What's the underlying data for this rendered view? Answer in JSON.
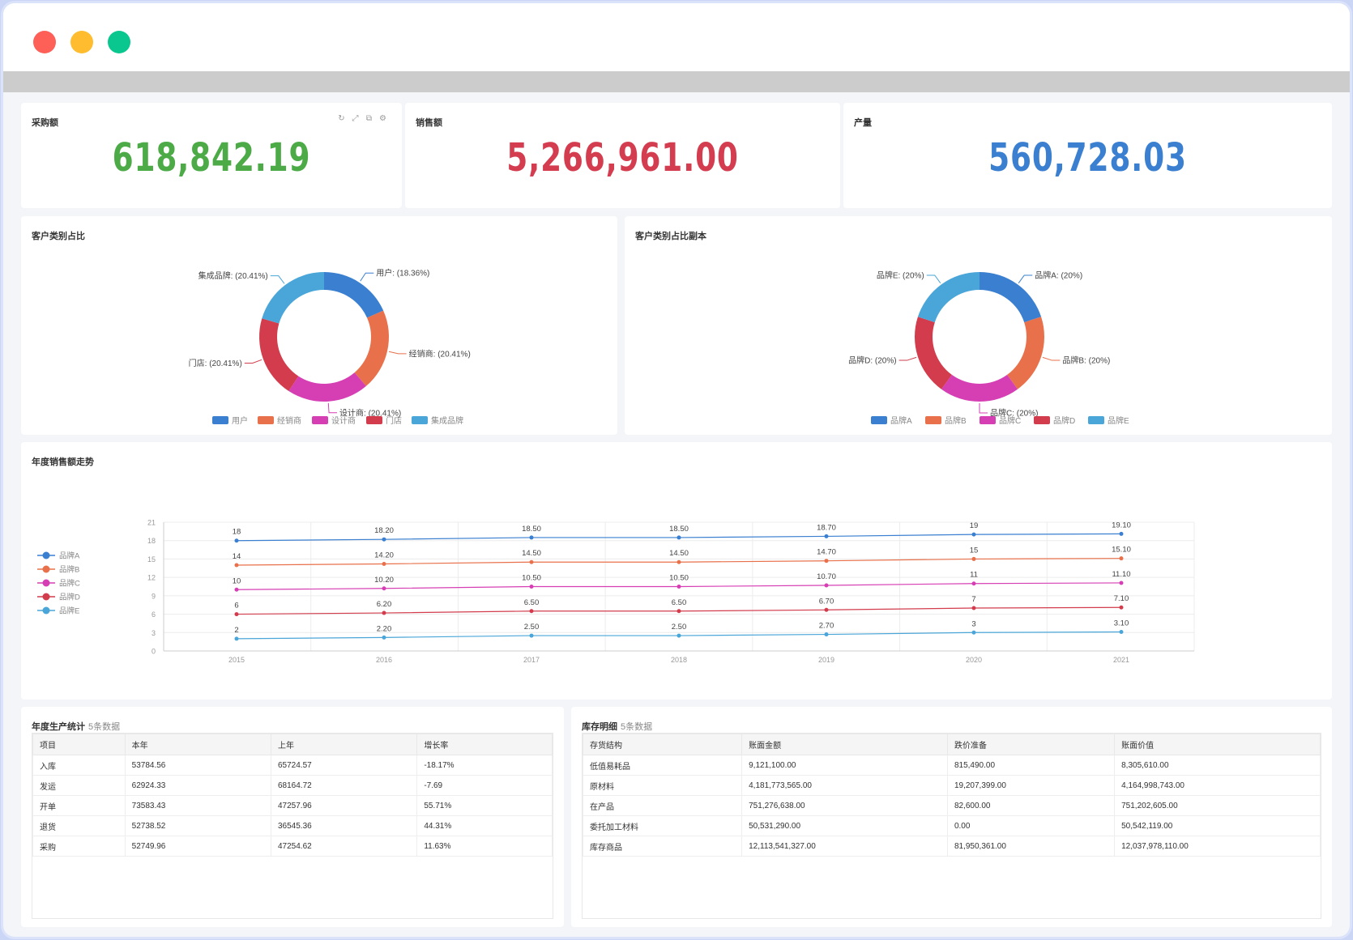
{
  "window": {
    "dots": [
      "close",
      "minimize",
      "maximize"
    ]
  },
  "kpis": [
    {
      "label": "采购额",
      "value": "618,842.19",
      "color": "#4caa47"
    },
    {
      "label": "销售额",
      "value": "5,266,961.00",
      "color": "#d33d4f"
    },
    {
      "label": "产量",
      "value": "560,728.03",
      "color": "#3b7fd0"
    }
  ],
  "card_tools": [
    "refresh-icon",
    "expand-icon",
    "copy-icon",
    "gear-icon"
  ],
  "donut1": {
    "title": "客户类别占比",
    "chart_data": {
      "type": "pie",
      "categories": [
        "用户",
        "经销商",
        "设计商",
        "门店",
        "集成品牌"
      ],
      "values": [
        18.36,
        20.41,
        20.41,
        20.41,
        20.41
      ],
      "labels": [
        "用户: (18.36%)",
        "经销商: (20.41%)",
        "设计商: (20.41%)",
        "门店: (20.41%)",
        "集成品牌: (20.41%)"
      ],
      "colors": [
        "#3a7fd0",
        "#e8704a",
        "#d63fb4",
        "#d23c4c",
        "#4aa6d8"
      ],
      "legend": "bottom"
    }
  },
  "donut2": {
    "title": "客户类别占比副本",
    "chart_data": {
      "type": "pie",
      "categories": [
        "品牌A",
        "品牌B",
        "品牌C",
        "品牌D",
        "品牌E"
      ],
      "values": [
        20,
        20,
        20,
        20,
        20
      ],
      "labels": [
        "品牌A: (20%)",
        "品牌B: (20%)",
        "品牌C: (20%)",
        "品牌D: (20%)",
        "品牌E: (20%)"
      ],
      "colors": [
        "#3a7fd0",
        "#e8704a",
        "#d63fb4",
        "#d23c4c",
        "#4aa6d8"
      ],
      "legend": "bottom"
    }
  },
  "line": {
    "title": "年度销售额走势",
    "chart_data": {
      "type": "line",
      "categories": [
        "2015",
        "2016",
        "2017",
        "2018",
        "2019",
        "2020",
        "2021"
      ],
      "ylim": [
        0,
        21
      ],
      "yticks": [
        0,
        3,
        6,
        9,
        12,
        15,
        18,
        21
      ],
      "grid": true,
      "legend": "left",
      "series": [
        {
          "name": "品牌A",
          "color": "#3a7fd0",
          "values": [
            18,
            18.2,
            18.5,
            18.5,
            18.7,
            19,
            19.1
          ],
          "labels": [
            "18",
            "18.20",
            "18.50",
            "18.50",
            "18.70",
            "19",
            "19.10"
          ]
        },
        {
          "name": "品牌B",
          "color": "#e8704a",
          "values": [
            14,
            14.2,
            14.5,
            14.5,
            14.7,
            15,
            15.1
          ],
          "labels": [
            "14",
            "14.20",
            "14.50",
            "14.50",
            "14.70",
            "15",
            "15.10"
          ]
        },
        {
          "name": "品牌C",
          "color": "#d63fb4",
          "values": [
            10,
            10.2,
            10.5,
            10.5,
            10.7,
            11,
            11.1
          ],
          "labels": [
            "10",
            "10.20",
            "10.50",
            "10.50",
            "10.70",
            "11",
            "11.10"
          ]
        },
        {
          "name": "品牌D",
          "color": "#d23c4c",
          "values": [
            6,
            6.2,
            6.5,
            6.5,
            6.7,
            7,
            7.1
          ],
          "labels": [
            "6",
            "6.20",
            "6.50",
            "6.50",
            "6.70",
            "7",
            "7.10"
          ]
        },
        {
          "name": "品牌E",
          "color": "#4aa6d8",
          "values": [
            2,
            2.2,
            2.5,
            2.5,
            2.7,
            3,
            3.1
          ],
          "labels": [
            "2",
            "2.20",
            "2.50",
            "2.50",
            "2.70",
            "3",
            "3.10"
          ]
        }
      ]
    }
  },
  "production": {
    "title": "年度生产统计",
    "subtitle": "5条数据",
    "columns": [
      "项目",
      "本年",
      "上年",
      "增长率"
    ],
    "rows": [
      [
        "入库",
        "53784.56",
        "65724.57",
        "-18.17%"
      ],
      [
        "发运",
        "62924.33",
        "68164.72",
        "-7.69"
      ],
      [
        "开单",
        "73583.43",
        "47257.96",
        "55.71%"
      ],
      [
        "退货",
        "52738.52",
        "36545.36",
        "44.31%"
      ],
      [
        "采购",
        "52749.96",
        "47254.62",
        "11.63%"
      ]
    ]
  },
  "inventory": {
    "title": "库存明细",
    "subtitle": "5条数据",
    "columns": [
      "存货结构",
      "账面金额",
      "跌价准备",
      "账面价值"
    ],
    "rows": [
      [
        "低值易耗品",
        "9,121,100.00",
        "815,490.00",
        "8,305,610.00"
      ],
      [
        "原材料",
        "4,181,773,565.00",
        "19,207,399.00",
        "4,164,998,743.00"
      ],
      [
        "在产品",
        "751,276,638.00",
        "82,600.00",
        "751,202,605.00"
      ],
      [
        "委托加工材料",
        "50,531,290.00",
        "0.00",
        "50,542,119.00"
      ],
      [
        "库存商品",
        "12,113,541,327.00",
        "81,950,361.00",
        "12,037,978,110.00"
      ]
    ]
  }
}
